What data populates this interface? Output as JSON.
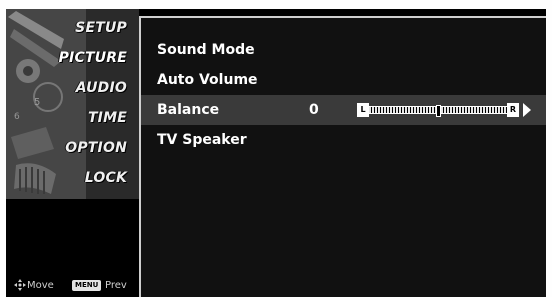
{
  "menu": {
    "items": [
      {
        "label": "SETUP",
        "selected": false
      },
      {
        "label": "PICTURE",
        "selected": false
      },
      {
        "label": "AUDIO",
        "selected": true
      },
      {
        "label": "TIME",
        "selected": false
      },
      {
        "label": "OPTION",
        "selected": false
      },
      {
        "label": "LOCK",
        "selected": false
      }
    ]
  },
  "footer": {
    "move_label": "Move",
    "menu_key": "MENU",
    "prev_label": "Prev",
    "move_icon": "dpad-icon"
  },
  "content": {
    "rows": [
      {
        "label": "Sound Mode"
      },
      {
        "label": "Auto Volume"
      },
      {
        "label": "Balance",
        "value": "0",
        "highlighted": true
      },
      {
        "label": "TV Speaker"
      }
    ],
    "balance_slider": {
      "left_marker": "L",
      "right_marker": "R",
      "value": 0,
      "min": -50,
      "max": 50
    }
  },
  "colors": {
    "background": "#000000",
    "content_background": "#111111",
    "highlight": "#3a3a3a",
    "text": "#ffffff",
    "frame": "#cfcfcf"
  }
}
